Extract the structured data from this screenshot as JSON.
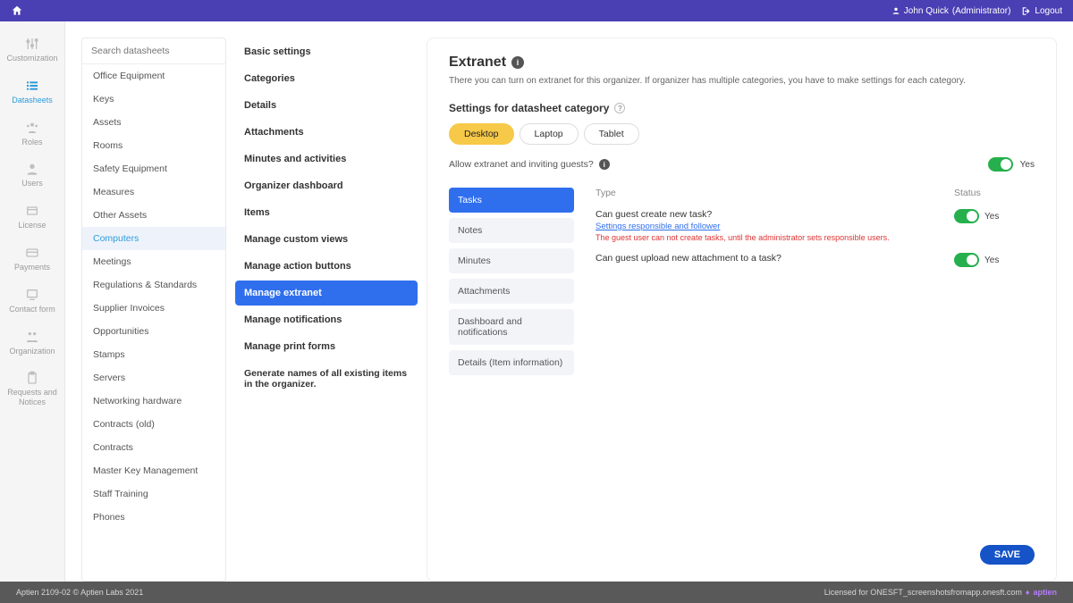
{
  "topbar": {
    "user_name": "John Quick",
    "user_role": "(Administrator)",
    "logout": "Logout"
  },
  "leftnav": [
    {
      "label": "Customization",
      "icon": "sliders"
    },
    {
      "label": "Datasheets",
      "icon": "list",
      "active": true
    },
    {
      "label": "Roles",
      "icon": "roles"
    },
    {
      "label": "Users",
      "icon": "user"
    },
    {
      "label": "License",
      "icon": "license"
    },
    {
      "label": "Payments",
      "icon": "card"
    },
    {
      "label": "Contact form",
      "icon": "contact"
    },
    {
      "label": "Organization",
      "icon": "org"
    },
    {
      "label": "Requests and Notices",
      "icon": "clipboard"
    }
  ],
  "datasheets": {
    "search_placeholder": "Search datasheets",
    "items": [
      "Office Equipment",
      "Keys",
      "Assets",
      "Rooms",
      "Safety Equipment",
      "Measures",
      "Other Assets",
      "Computers",
      "Meetings",
      "Regulations & Standards",
      "Supplier Invoices",
      "Opportunities",
      "Stamps",
      "Servers",
      "Networking hardware",
      "Contracts (old)",
      "Contracts",
      "Master Key Management",
      "Staff Training",
      "Phones"
    ],
    "active_index": 7
  },
  "settings_menu": {
    "items": [
      "Basic settings",
      "Categories",
      "Details",
      "Attachments",
      "Minutes and activities",
      "Organizer dashboard",
      "Items",
      "Manage custom views",
      "Manage action buttons",
      "Manage extranet",
      "Manage notifications",
      "Manage print forms",
      "Generate names of all existing items in the organizer."
    ],
    "active_index": 9
  },
  "extranet": {
    "title": "Extranet",
    "desc": "There you can turn on extranet for this organizer. If organizer has multiple categories, you have to make settings for each category.",
    "settings_heading": "Settings for datasheet category",
    "devices": [
      "Desktop",
      "Laptop",
      "Tablet"
    ],
    "device_active": 0,
    "allow_label": "Allow extranet and inviting guests?",
    "allow_value": "Yes",
    "tabs": [
      "Tasks",
      "Notes",
      "Minutes",
      "Attachments",
      "Dashboard and notifications",
      "Details (Item information)"
    ],
    "tab_active": 0,
    "perm_header_type": "Type",
    "perm_header_status": "Status",
    "perms": [
      {
        "label": "Can guest create new task?",
        "status": "Yes",
        "link": "Settings responsible and follower",
        "warn": "The guest user can not create tasks, until the administrator sets responsible users."
      },
      {
        "label": "Can guest upload new attachment to a task?",
        "status": "Yes"
      }
    ],
    "save": "SAVE"
  },
  "footer": {
    "left": "Aptien 2109-02 © Aptien Labs 2021",
    "right": "Licensed for ONESFT_screenshotsfromapp.onesft.com",
    "brand": "aptien"
  }
}
